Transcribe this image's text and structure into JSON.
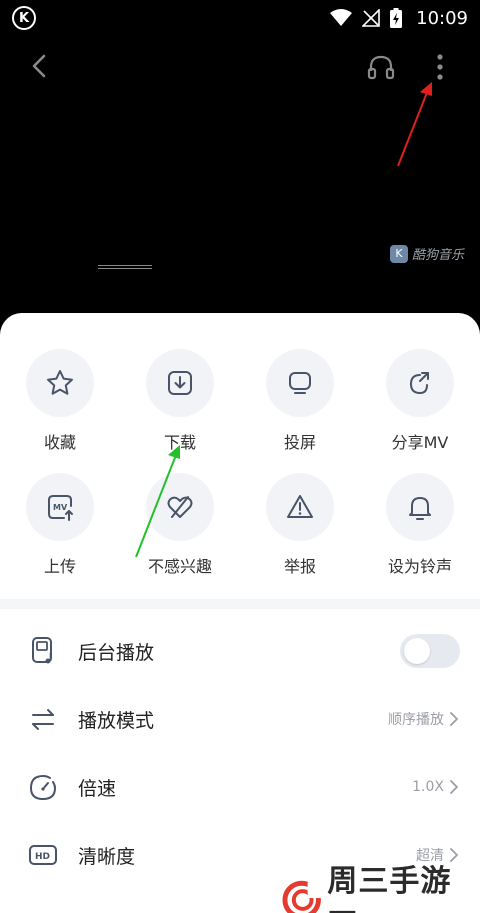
{
  "status_bar": {
    "time": "10:09",
    "app_badge": "K"
  },
  "video": {
    "watermark": "酷狗音乐",
    "watermark_badge": "K"
  },
  "actions_row1": [
    {
      "label": "收藏",
      "icon": "star-icon"
    },
    {
      "label": "下载",
      "icon": "download-icon"
    },
    {
      "label": "投屏",
      "icon": "cast-screen-icon"
    },
    {
      "label": "分享MV",
      "icon": "share-icon"
    }
  ],
  "actions_row2": [
    {
      "label": "上传",
      "icon": "upload-mv-icon"
    },
    {
      "label": "不感兴趣",
      "icon": "dislike-heart-icon"
    },
    {
      "label": "举报",
      "icon": "report-warning-icon"
    },
    {
      "label": "设为铃声",
      "icon": "bell-icon"
    }
  ],
  "settings": {
    "background_play": {
      "label": "后台播放",
      "enabled": false
    },
    "play_mode": {
      "label": "播放模式",
      "value": "顺序播放"
    },
    "speed": {
      "label": "倍速",
      "value": "1.0X"
    },
    "quality": {
      "label": "清晰度",
      "value": "超清",
      "icon_text": "HD"
    }
  },
  "brand_watermark": {
    "text": "周三手游网"
  },
  "colors": {
    "sheet_bg": "#ffffff",
    "circle_bg": "#f1f3f7",
    "icon_stroke": "#4a5468",
    "annotation_red": "#e02020",
    "annotation_green": "#22c02a"
  }
}
